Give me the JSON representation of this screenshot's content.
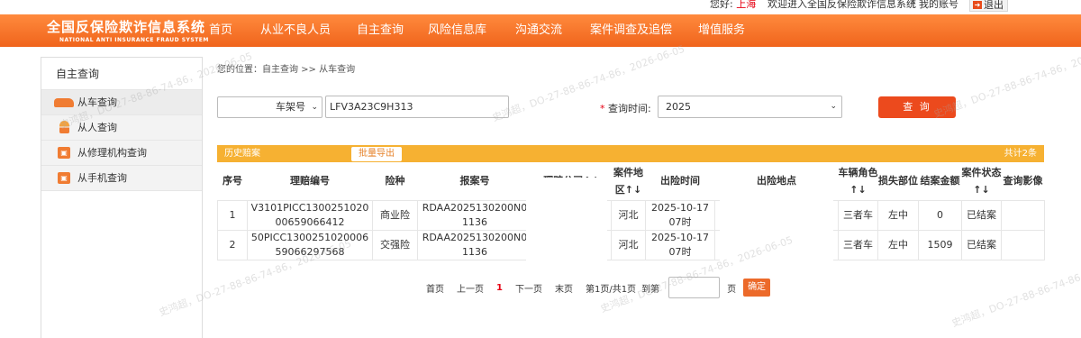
{
  "topbar": {
    "greeting": "您好:",
    "region": "上海",
    "welcome": "欢迎进入全国反保险欺诈信息系统",
    "separator": "|",
    "my_account": "我的账号",
    "logout": "退出"
  },
  "logo": {
    "title_cn": "全国反保险欺诈信息系统",
    "title_en": "NATIONAL ANTI INSURANCE FRAUD SYSTEM"
  },
  "nav": [
    "首页",
    "从业不良人员",
    "自主查询",
    "风险信息库",
    "沟通交流",
    "案件调查及追偿",
    "增值服务"
  ],
  "sidebar": {
    "heading": "自主查询",
    "items": [
      {
        "label": "从车查询",
        "icon": "car-icon"
      },
      {
        "label": "从人查询",
        "icon": "person-icon"
      },
      {
        "label": "从修理机构查询",
        "icon": "repair-shop-icon"
      },
      {
        "label": "从手机查询",
        "icon": "phone-icon"
      }
    ]
  },
  "breadcrumb": "您的位置：自主查询 >> 从车查询",
  "search": {
    "id_type": "车架号",
    "vin_value": "LFV3A23C9H313",
    "time_label": "查询时间:",
    "time_value": "2025",
    "query_button": "查 询"
  },
  "table": {
    "bar_title": "历史赔案",
    "export_button": "批量导出",
    "total": "共计2条",
    "headers": [
      "序号",
      "理赔编号",
      "险种",
      "报案号",
      "理赔公司↑↓",
      "案件地区↑↓",
      "出险时间",
      "出险地点",
      "车辆角色↑↓",
      "损失部位",
      "结案金额",
      "案件状态↑↓",
      "查询影像"
    ],
    "rows": [
      [
        "1",
        "V3101PICC130025102000659066412",
        "商业险",
        "RDAA2025130200N01136",
        "",
        "河北",
        "2025-10-17 07时",
        "",
        "三者车",
        "左中",
        "0",
        "已结案",
        ""
      ],
      [
        "2",
        "50PICC130025102000659066297568",
        "交强险",
        "RDAA2025130200N01136",
        "",
        "河北",
        "2025-10-17 07时",
        "",
        "三者车",
        "左中",
        "1509",
        "已结案",
        ""
      ]
    ]
  },
  "pager": {
    "first": "首页",
    "prev": "上一页",
    "current": "1",
    "next": "下一页",
    "last": "末页",
    "info": "第1页/共1页",
    "goto": "到第",
    "page_unit": "页",
    "confirm": "确定"
  },
  "watermark": "史鸿超，DO-27-88-86-74-86，2026-06-05"
}
